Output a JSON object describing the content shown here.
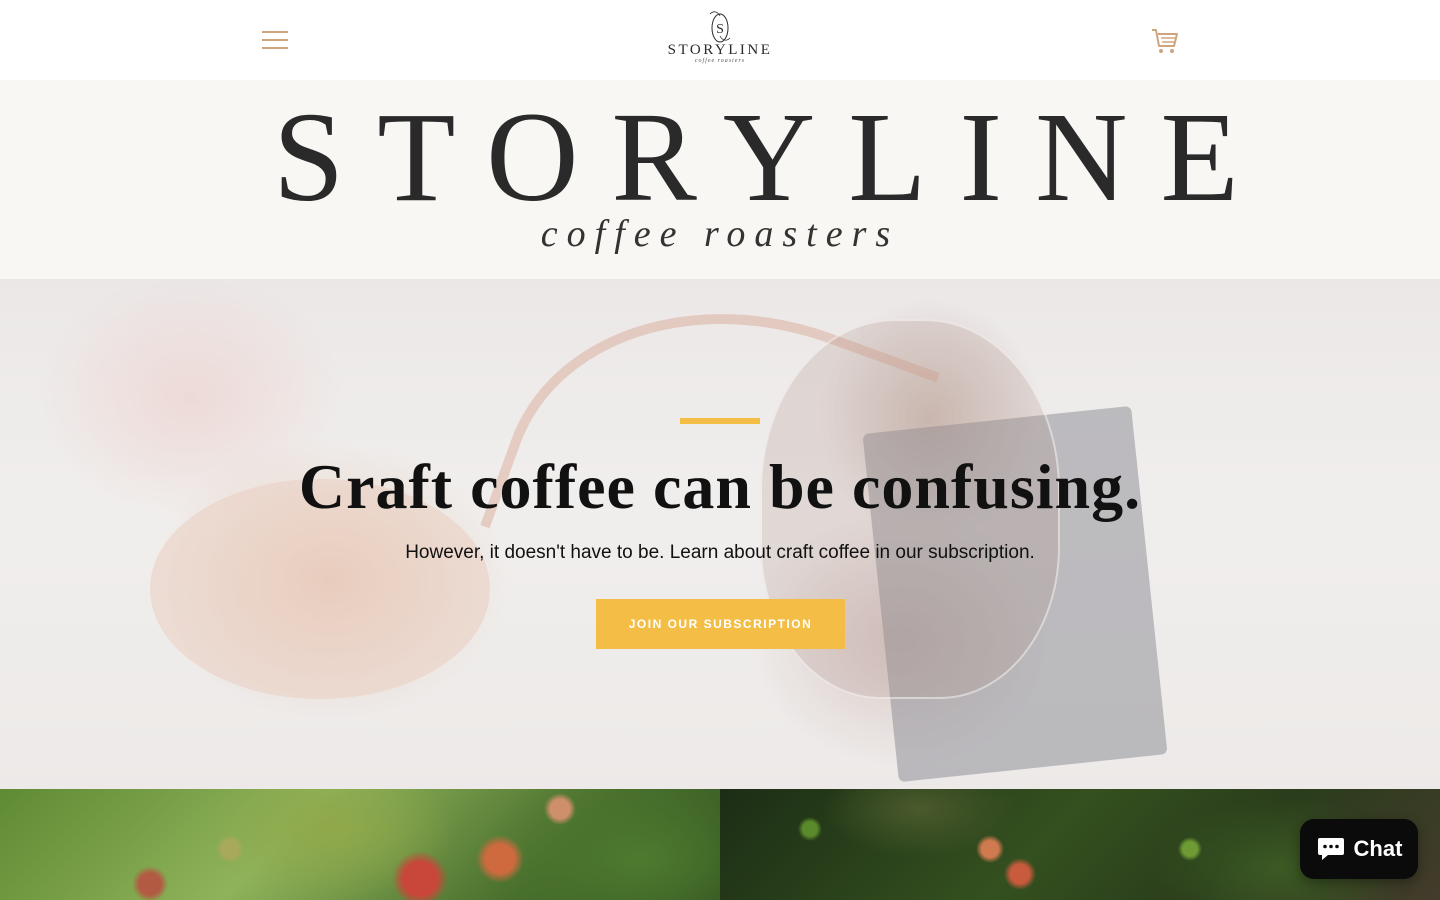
{
  "header": {
    "menu_icon": "hamburger-menu-icon",
    "logo_brand": "STORYLINE",
    "logo_sub": "coffee roasters",
    "logo_letter": "S",
    "cart_icon": "shopping-cart-icon"
  },
  "banner": {
    "title": "STORYLINE",
    "subtitle": "coffee roasters"
  },
  "hero": {
    "heading": "Craft coffee can be confusing.",
    "text": "However, it doesn't have to be. Learn about craft coffee in our subscription.",
    "cta_label": "JOIN OUR SUBSCRIPTION"
  },
  "chat": {
    "label": "Chat",
    "icon": "chat-bubble-icon"
  },
  "colors": {
    "accent": "#f4bd46",
    "icon_tan": "#cfa57d",
    "banner_bg": "#f8f7f3",
    "chat_bg": "#0b0b0b"
  }
}
